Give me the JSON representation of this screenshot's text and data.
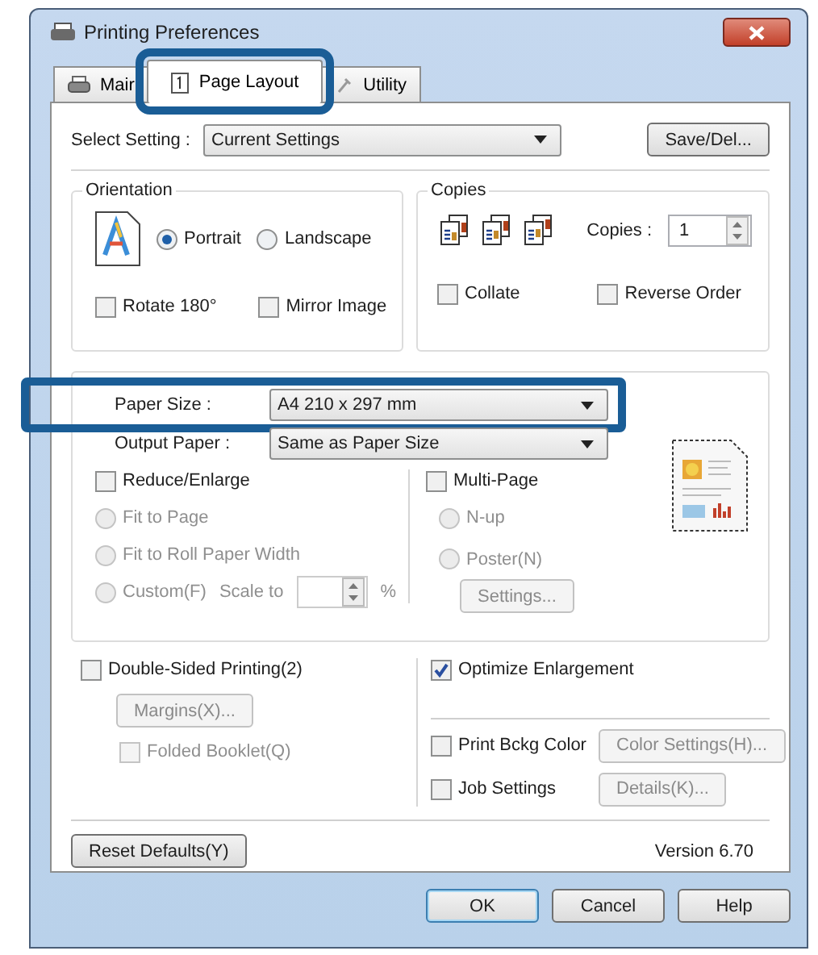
{
  "window": {
    "title": "Printing Preferences"
  },
  "tabs": [
    {
      "label": "Mair",
      "selected": false,
      "highlighted": false
    },
    {
      "label": "Page Layout",
      "selected": true,
      "highlighted": true
    },
    {
      "label": "Utility",
      "selected": false,
      "highlighted": false
    }
  ],
  "select_setting": {
    "label": "Select Setting :",
    "value": "Current Settings",
    "button": "Save/Del..."
  },
  "orientation": {
    "title": "Orientation",
    "options": [
      {
        "label": "Portrait",
        "selected": true
      },
      {
        "label": "Landscape",
        "selected": false
      }
    ],
    "checks": [
      {
        "label": "Rotate 180°",
        "checked": false
      },
      {
        "label": "Mirror Image",
        "checked": false
      }
    ]
  },
  "copies": {
    "title": "Copies",
    "label": "Copies :",
    "value": "1",
    "checks": [
      {
        "label": "Collate",
        "checked": false
      },
      {
        "label": "Reverse Order",
        "checked": false
      }
    ]
  },
  "paper": {
    "fields": [
      {
        "label": "Paper Size :",
        "value": "A4 210 x 297 mm",
        "highlighted": true
      },
      {
        "label": "Output Paper :",
        "value": "Same as Paper Size",
        "highlighted": false
      }
    ],
    "reduce": {
      "label": "Reduce/Enlarge",
      "checked": false,
      "options": [
        {
          "label": "Fit to Page",
          "selected": false,
          "disabled": true
        },
        {
          "label": "Fit to Roll Paper Width",
          "selected": false,
          "disabled": true
        },
        {
          "label": "Custom(F)",
          "selected": false,
          "disabled": true
        }
      ],
      "scale_label": "Scale to",
      "unit": "%"
    },
    "multi": {
      "label": "Multi-Page",
      "checked": false,
      "options": [
        {
          "label": "N-up",
          "selected": false,
          "disabled": true
        },
        {
          "label": "Poster(N)",
          "selected": false,
          "disabled": true
        }
      ],
      "button": {
        "label": "Settings...",
        "disabled": true
      }
    }
  },
  "double_sided": {
    "label": "Double-Sided Printing(2)",
    "checked": false,
    "button": {
      "label": "Margins(X)...",
      "disabled": true
    },
    "booklet": {
      "label": "Folded Booklet(Q)",
      "checked": false,
      "disabled": true
    }
  },
  "optimize": {
    "label": "Optimize Enlargement",
    "checked": true
  },
  "extras": [
    {
      "label": "Print Bckg Color",
      "checked": false,
      "button": {
        "label": "Color Settings(H)...",
        "disabled": true
      }
    },
    {
      "label": "Job Settings",
      "checked": false,
      "button": {
        "label": "Details(K)...",
        "disabled": true
      }
    }
  ],
  "reset_button": "Reset Defaults(Y)",
  "version": "Version 6.70",
  "buttons": [
    {
      "label": "OK",
      "default": true
    },
    {
      "label": "Cancel",
      "default": false
    },
    {
      "label": "Help",
      "default": false
    }
  ]
}
